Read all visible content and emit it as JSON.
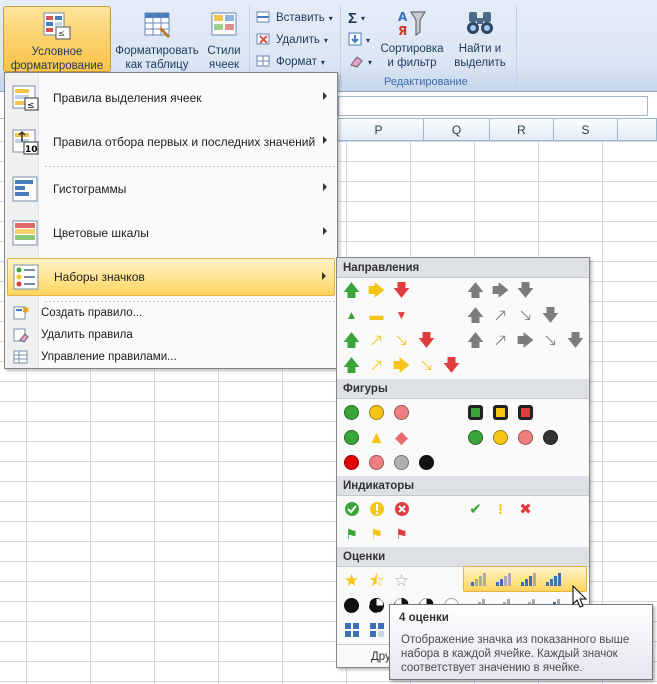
{
  "ribbon": {
    "cond_format": "Условное форматирование",
    "format_table": "Форматировать как таблицу",
    "cell_styles": "Стили ячеек",
    "insert": "Вставить",
    "delete": "Удалить",
    "format": "Формат",
    "sum_symbol": "Σ",
    "sort_filter": "Сортировка и фильтр",
    "find_select": "Найти и выделить",
    "editing_group": "Редактирование"
  },
  "columns": [
    "P",
    "Q",
    "R",
    "S"
  ],
  "menu": {
    "items": [
      {
        "label": "Правила выделения ячеек",
        "icon": "highlight-rules-icon"
      },
      {
        "label": "Правила отбора первых и последних значений",
        "icon": "top-bottom-rules-icon"
      },
      {
        "label": "Гистограммы",
        "icon": "data-bars-icon"
      },
      {
        "label": "Цветовые шкалы",
        "icon": "color-scales-icon"
      },
      {
        "label": "Наборы значков",
        "icon": "icon-sets-icon"
      }
    ],
    "small_items": [
      {
        "label": "Создать правило..."
      },
      {
        "label": "Удалить правила"
      },
      {
        "label": "Управление правилами..."
      }
    ]
  },
  "submenu": {
    "sections": [
      "Направления",
      "Фигуры",
      "Индикаторы",
      "Оценки"
    ],
    "more_label": "Дру"
  },
  "tooltip": {
    "title": "4 оценки",
    "description": "Отображение значка из показанного выше набора в каждой ячейке. Каждый значок соответствует значению в ячейке."
  },
  "colors": {
    "green": "#3aa53a",
    "yellow": "#f5c518",
    "red": "#e03c3c",
    "gray": "#7c7c7c",
    "highlight": "#ffe28a"
  }
}
